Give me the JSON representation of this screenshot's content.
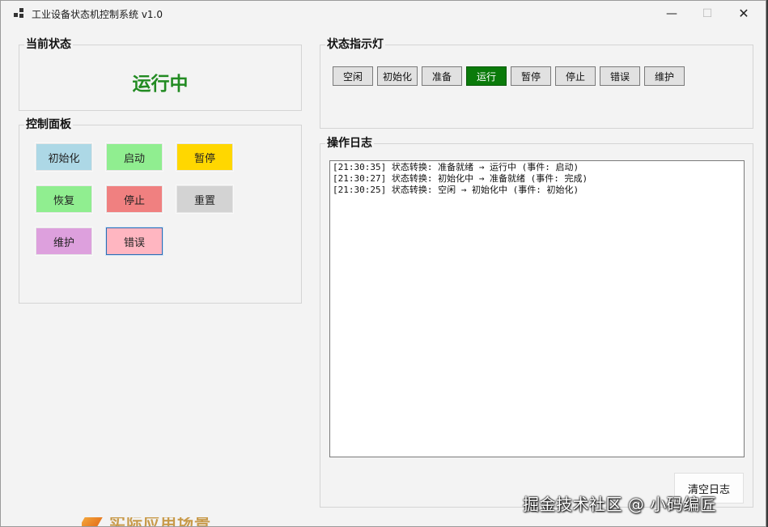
{
  "window": {
    "title": "工业设备状态机控制系统 v1.0",
    "controls": {
      "minimize": "—",
      "maximize": "☐",
      "close": "✕"
    }
  },
  "current_state": {
    "group_title": "当前状态",
    "value": "运行中",
    "color": "#228b22"
  },
  "control_panel": {
    "group_title": "控制面板",
    "buttons": [
      {
        "label": "初始化",
        "color": "#add8e6"
      },
      {
        "label": "启动",
        "color": "#90ee90"
      },
      {
        "label": "暂停",
        "color": "#ffd700"
      },
      {
        "label": "恢复",
        "color": "#90ee90"
      },
      {
        "label": "停止",
        "color": "#f08080"
      },
      {
        "label": "重置",
        "color": "#d3d3d3"
      },
      {
        "label": "维护",
        "color": "#dda0dd"
      },
      {
        "label": "错误",
        "color": "#ffb6c1"
      }
    ]
  },
  "indicators": {
    "group_title": "状态指示灯",
    "items": [
      {
        "label": "空闲",
        "active": false
      },
      {
        "label": "初始化",
        "active": false
      },
      {
        "label": "准备",
        "active": false
      },
      {
        "label": "运行",
        "active": true
      },
      {
        "label": "暂停",
        "active": false
      },
      {
        "label": "停止",
        "active": false
      },
      {
        "label": "错误",
        "active": false
      },
      {
        "label": "维护",
        "active": false
      }
    ],
    "active_color": "#0a7a0a"
  },
  "log": {
    "group_title": "操作日志",
    "lines": [
      "[21:30:35] 状态转换: 准备就绪 → 运行中 (事件: 启动)",
      "[21:30:27] 状态转换: 初始化中 → 准备就绪 (事件: 完成)",
      "[21:30:25] 状态转换: 空闲 → 初始化中 (事件: 初始化)"
    ],
    "clear_button": "清空日志"
  },
  "overlay": {
    "watermark": "掘金技术社区 @ 小码编匠",
    "bottom_partial": "实际应用场景"
  }
}
